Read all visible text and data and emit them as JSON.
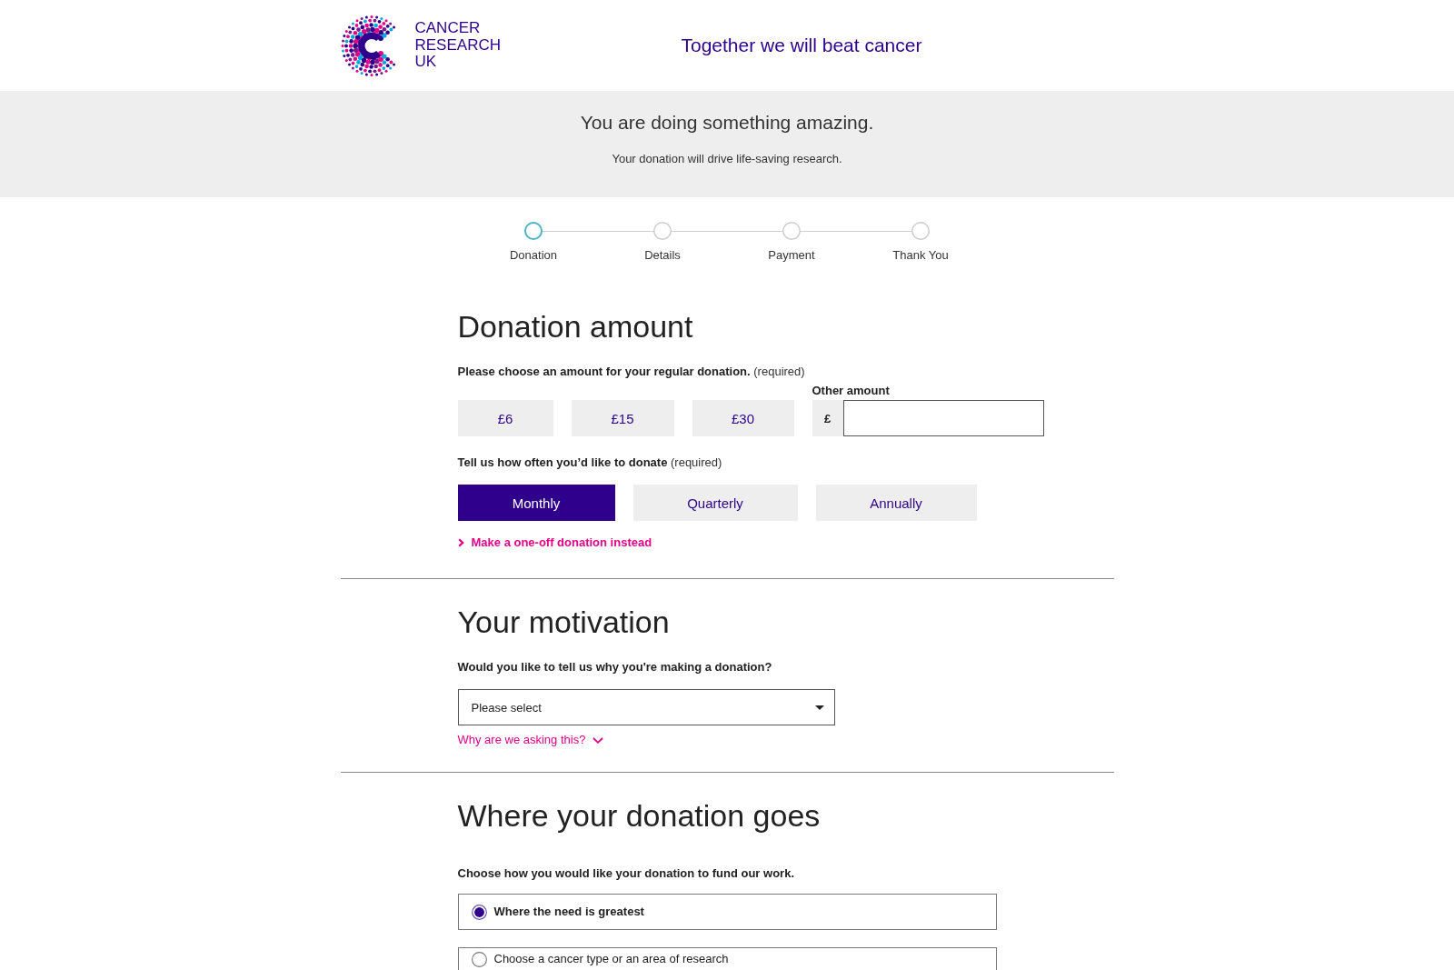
{
  "header": {
    "logo": {
      "lines": [
        "CANCER",
        "RESEARCH",
        "UK"
      ]
    },
    "tagline": "Together we will beat cancer"
  },
  "banner": {
    "title": "You are doing something amazing.",
    "subtitle": "Your donation will drive life-saving research."
  },
  "steps": [
    {
      "label": "Donation",
      "selected": true
    },
    {
      "label": "Details",
      "selected": false
    },
    {
      "label": "Payment",
      "selected": false
    },
    {
      "label": "Thank You",
      "selected": false
    }
  ],
  "donation_amount": {
    "title": "Donation amount",
    "amount_prompt": "**Please choose an amount for your regular donation.** (required)",
    "amounts": [
      {
        "label": "£6",
        "selected": false
      },
      {
        "label": "£15",
        "selected": false
      },
      {
        "label": "£30",
        "selected": false
      }
    ],
    "other_amount": {
      "label": "Other amount",
      "prefix": "£"
    },
    "frequency_prompt": "**Tell us how often you’d like to donate** (required)",
    "frequencies": [
      {
        "label": "Monthly",
        "selected": true
      },
      {
        "label": "Quarterly",
        "selected": false
      },
      {
        "label": "Annually",
        "selected": false
      }
    ],
    "one_off_link": "Make a one-off donation instead"
  },
  "motivation": {
    "title": "Your motivation",
    "question": "Would you like to tell us why you're making a donation?",
    "select": {
      "value": "Please select"
    },
    "help_link": "Why are we asking this?"
  },
  "donation_destination": {
    "title": "Where your donation goes",
    "prompt": "Choose how you would like your donation to fund our work.",
    "options": [
      {
        "label": "Where the need is greatest",
        "selected": true
      },
      {
        "label": "Choose a cancer type or an area of research",
        "selected": false
      }
    ]
  }
}
